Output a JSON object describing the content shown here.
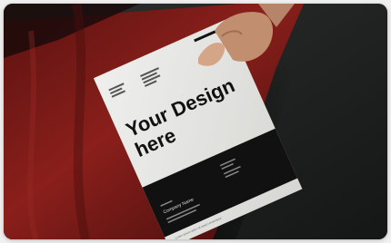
{
  "photo": {
    "flyer": {
      "headline_line1": "Your Design",
      "headline_line2": "here",
      "name_label": "Company Name",
      "small_text": "Lorem ipsum dolor sit amet consectetur"
    }
  },
  "colors": {
    "backdrop_red": "#7a1a18",
    "backdrop_dark": "#202322",
    "paper": "#e4e4e2",
    "ink": "#111111",
    "skin": "#c89a7c"
  }
}
